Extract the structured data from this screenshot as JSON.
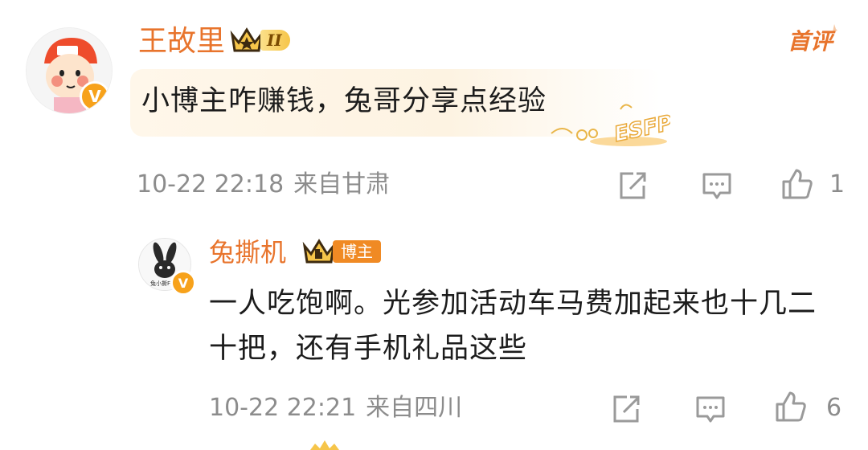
{
  "comments": [
    {
      "author": "王故里",
      "fan_level": "II",
      "tag": "首评",
      "text": "小博主咋赚钱，兔哥分享点经验",
      "decoration": "ESFP",
      "time": "10-22 22:18",
      "location": "来自甘肃",
      "likes": "1"
    }
  ],
  "reply": {
    "author": "兔撕机",
    "role_badge": "博主",
    "avatar_caption": "兔小撕Fly",
    "text": "一人吃饱啊。光参加活动车马费加起来也十几二十把，还有手机礼品这些",
    "time": "10-22 22:21",
    "location": "来自四川",
    "likes": "6"
  },
  "icons": {
    "share": "share-icon",
    "reply": "comment-icon",
    "like": "thumbs-up-icon",
    "verified": "verified-v-icon",
    "crown": "crown-icon"
  },
  "colors": {
    "name": "#e8742c",
    "meta": "#8c8c8c",
    "badge_gold": "#f6c54a",
    "verified": "#f7a21b",
    "role_badge": "#f08a24"
  }
}
